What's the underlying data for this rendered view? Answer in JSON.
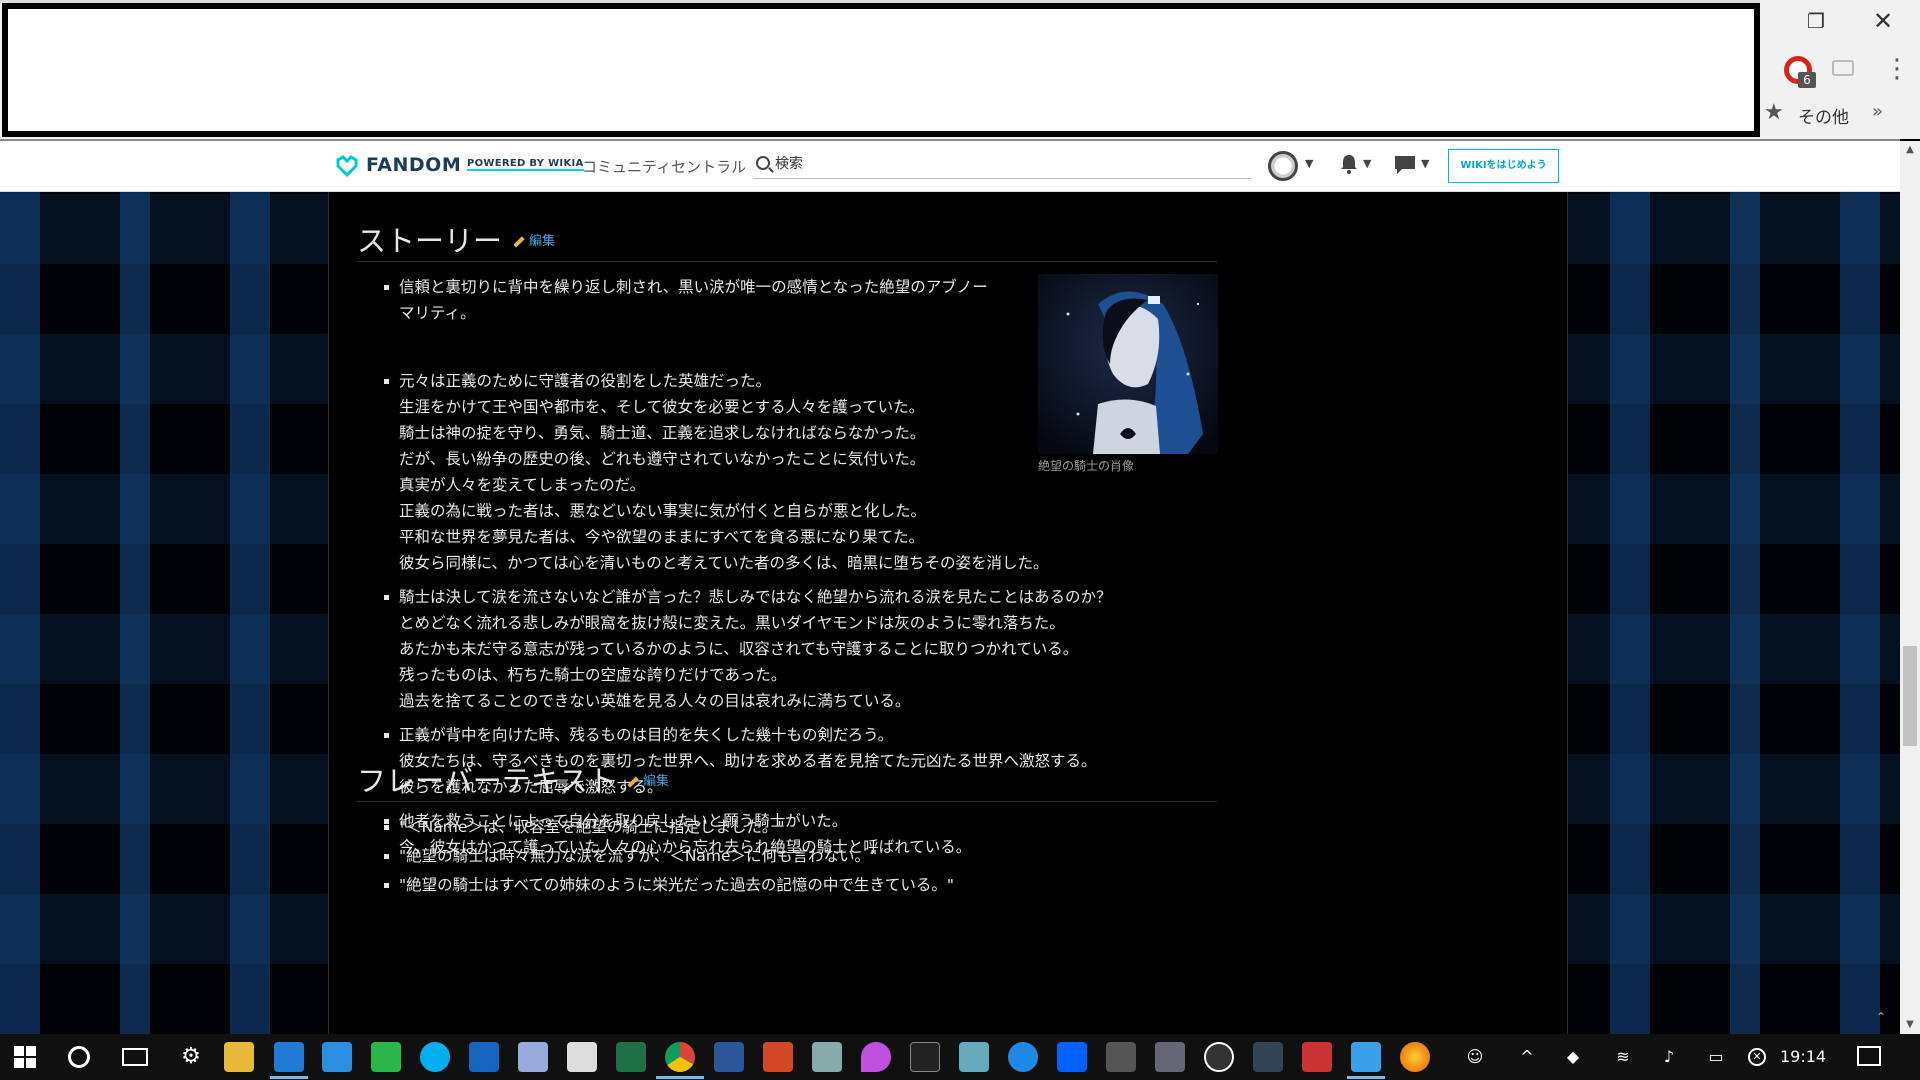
{
  "browser": {
    "bookmarks_other": "その他",
    "extension_badge": "6"
  },
  "fandom_nav": {
    "logo_text": "FANDOM",
    "powered_by": "POWERED BY WIKIA",
    "community_central": "コミュニティセントラル",
    "search_placeholder": "検索",
    "start_wiki_button": "WIKIをはじめよう"
  },
  "article": {
    "story": {
      "heading": "ストーリー",
      "edit_label": "編集",
      "image_caption": "絶望の騎士の肖像",
      "bullets": [
        [
          "信頼と裏切りに背中を繰り返し刺され、黒い涙が唯一の感情となった絶望のアブノー",
          "マリティ。"
        ],
        [
          "元々は正義のために守護者の役割をした英雄だった。",
          "生涯をかけて王や国や都市を、そして彼女を必要とする人々を護っていた。",
          "騎士は神の掟を守り、勇気、騎士道、正義を追求しなければならなかった。",
          "だが、長い紛争の歴史の後、どれも遵守されていなかったことに気付いた。",
          "真実が人々を変えてしまったのだ。",
          "正義の為に戦った者は、悪などいない事実に気が付くと自らが悪と化した。",
          "平和な世界を夢見た者は、今や欲望のままにすべてを貪る悪になり果てた。",
          "彼女ら同様に、かつては心を清いものと考えていた者の多くは、暗黒に堕ちその姿を消した。"
        ],
        [
          "騎士は決して涙を流さないなど誰が言った？悲しみではなく絶望から流れる涙を見たことはあるのか？",
          "とめどなく流れる悲しみが眼窩を抜け殻に変えた。黒いダイヤモンドは灰のように零れ落ちた。",
          "あたかも未だ守る意志が残っているかのように、収容されても守護することに取りつかれている。",
          "残ったものは、朽ちた騎士の空虚な誇りだけであった。",
          "過去を捨てることのできない英雄を見る人々の目は哀れみに満ちている。"
        ],
        [
          "正義が背中を向けた時、残るものは目的を失くした幾十もの剣だろう。",
          "彼女たちは、守るべきものを裏切った世界へ、助けを求める者を見捨てた元凶たる世界へ激怒する。",
          "彼らを護れなかった屈辱で激怒する。"
        ],
        [
          "他者を救うことによって自分を取り戻したいと願う騎士がいた。",
          "今、彼女はかつて護っていた人々の心から忘れ去られ絶望の騎士と呼ばれている。"
        ]
      ]
    },
    "flavor": {
      "heading": "フレーバーテキスト",
      "edit_label": "編集",
      "bullets": [
        "\"＜Name＞は、収容室を絶望の騎士に指定しました。\"",
        "\"絶望の騎士は時々無力な涙を流すが、＜Name＞に何も言わない。\"",
        "\"絶望の騎士はすべての姉妹のように栄光だった過去の記憶の中で生きている。\""
      ]
    }
  },
  "taskbar": {
    "clock": "19:14",
    "icons": [
      "settings-icon",
      "file-explorer-icon",
      "edge-icon",
      "ie-icon",
      "line-icon",
      "skype-icon",
      "app-icon",
      "app-icon",
      "mail-icon",
      "excel-icon",
      "chrome-icon",
      "word-icon",
      "powerpoint-icon",
      "app-icon",
      "maps-icon",
      "terminal-icon",
      "app-icon",
      "app-icon",
      "dropbox-icon",
      "calculator-icon",
      "app-icon",
      "app-icon",
      "app-icon",
      "app-icon",
      "ie-icon",
      "firefox-icon"
    ]
  },
  "colors": {
    "fandom_accent": "#00d6d6",
    "link": "#4aa3df",
    "taskbar_active": "#76b9ed"
  }
}
